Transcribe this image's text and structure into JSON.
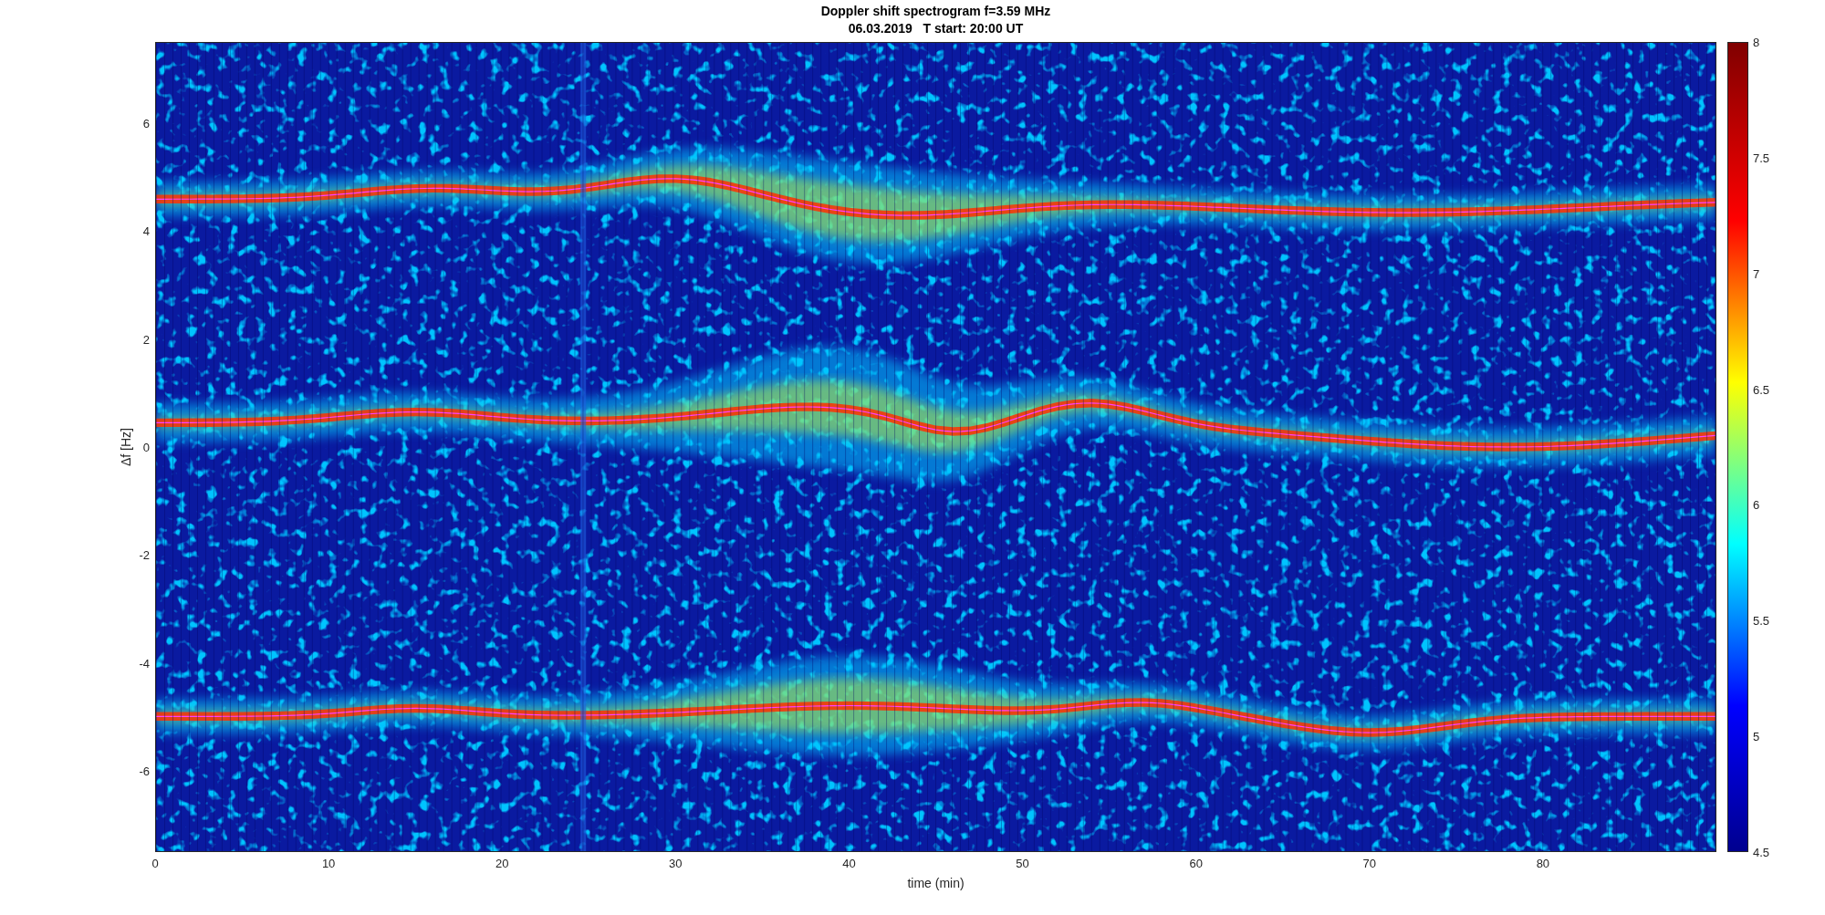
{
  "figure": {
    "title": "Doppler shift spectrogram f=3.59 MHz",
    "subtitle": "06.03.2019   T start: 20:00 UT",
    "xlabel": "time (min)",
    "ylabel": "Δf [Hz]",
    "x_ticks": [
      "0",
      "10",
      "20",
      "30",
      "40",
      "50",
      "60",
      "70",
      "80"
    ],
    "y_ticks": [
      "6",
      "4",
      "2",
      "0",
      "-2",
      "-4",
      "-6"
    ],
    "colorbar_ticks": [
      "8",
      "7.5",
      "7",
      "6.5",
      "6",
      "5.5",
      "5",
      "4.5"
    ]
  }
}
